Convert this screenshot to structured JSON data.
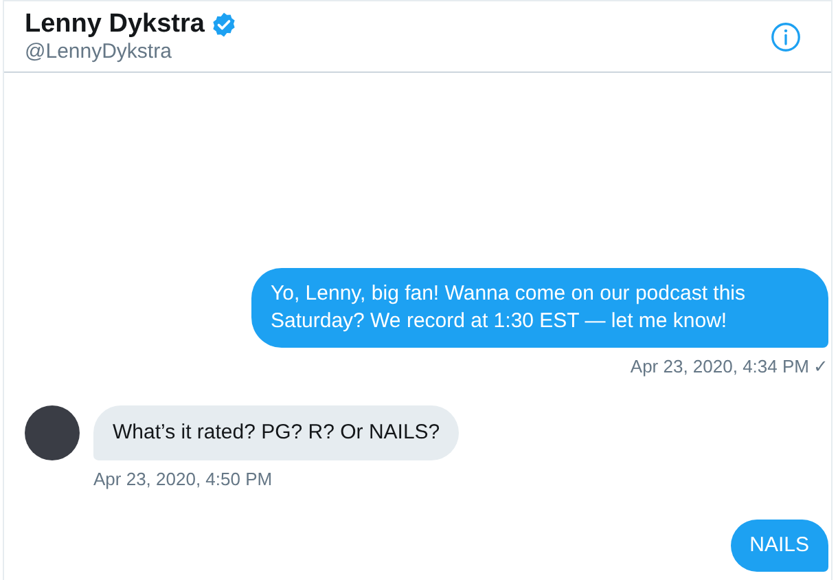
{
  "header": {
    "name": "Lenny Dykstra",
    "verified": true,
    "handle": "@LennyDykstra"
  },
  "messages": [
    {
      "kind": "outgoing",
      "text": "Yo, Lenny, big fan! Wanna come on our podcast this Saturday? We record at 1:30 EST — let me know!",
      "time": "Apr 23, 2020, 4:34 PM",
      "receipt": "✓"
    },
    {
      "kind": "incoming",
      "text": "What’s it rated? PG? R? Or NAILS?",
      "time": "Apr 23, 2020, 4:50 PM"
    },
    {
      "kind": "outgoing",
      "text": "NAILS"
    }
  ]
}
